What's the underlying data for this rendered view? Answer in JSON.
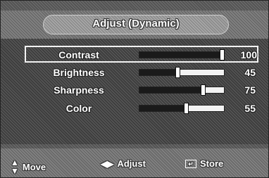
{
  "header": {
    "title": "Adjust (Dynamic)"
  },
  "settings": [
    {
      "label": "Contrast",
      "value": "100",
      "level": 100,
      "selected": true
    },
    {
      "label": "Brightness",
      "value": "45",
      "level": 45,
      "selected": false
    },
    {
      "label": "Sharpness",
      "value": "75",
      "level": 75,
      "selected": false
    },
    {
      "label": "Color",
      "value": "55",
      "level": 55,
      "selected": false
    }
  ],
  "footer": {
    "move_label": "Move",
    "adjust_label": "Adjust",
    "store_label": "Store",
    "move_icon": "up-down-arrows-icon",
    "adjust_icon": "left-right-arrows-icon",
    "store_icon": "enter-icon"
  },
  "colors": {
    "selection_border": "#f2f2f2",
    "bar_fill": "#1a1a1a",
    "bar_track": "#f3f3f3"
  }
}
